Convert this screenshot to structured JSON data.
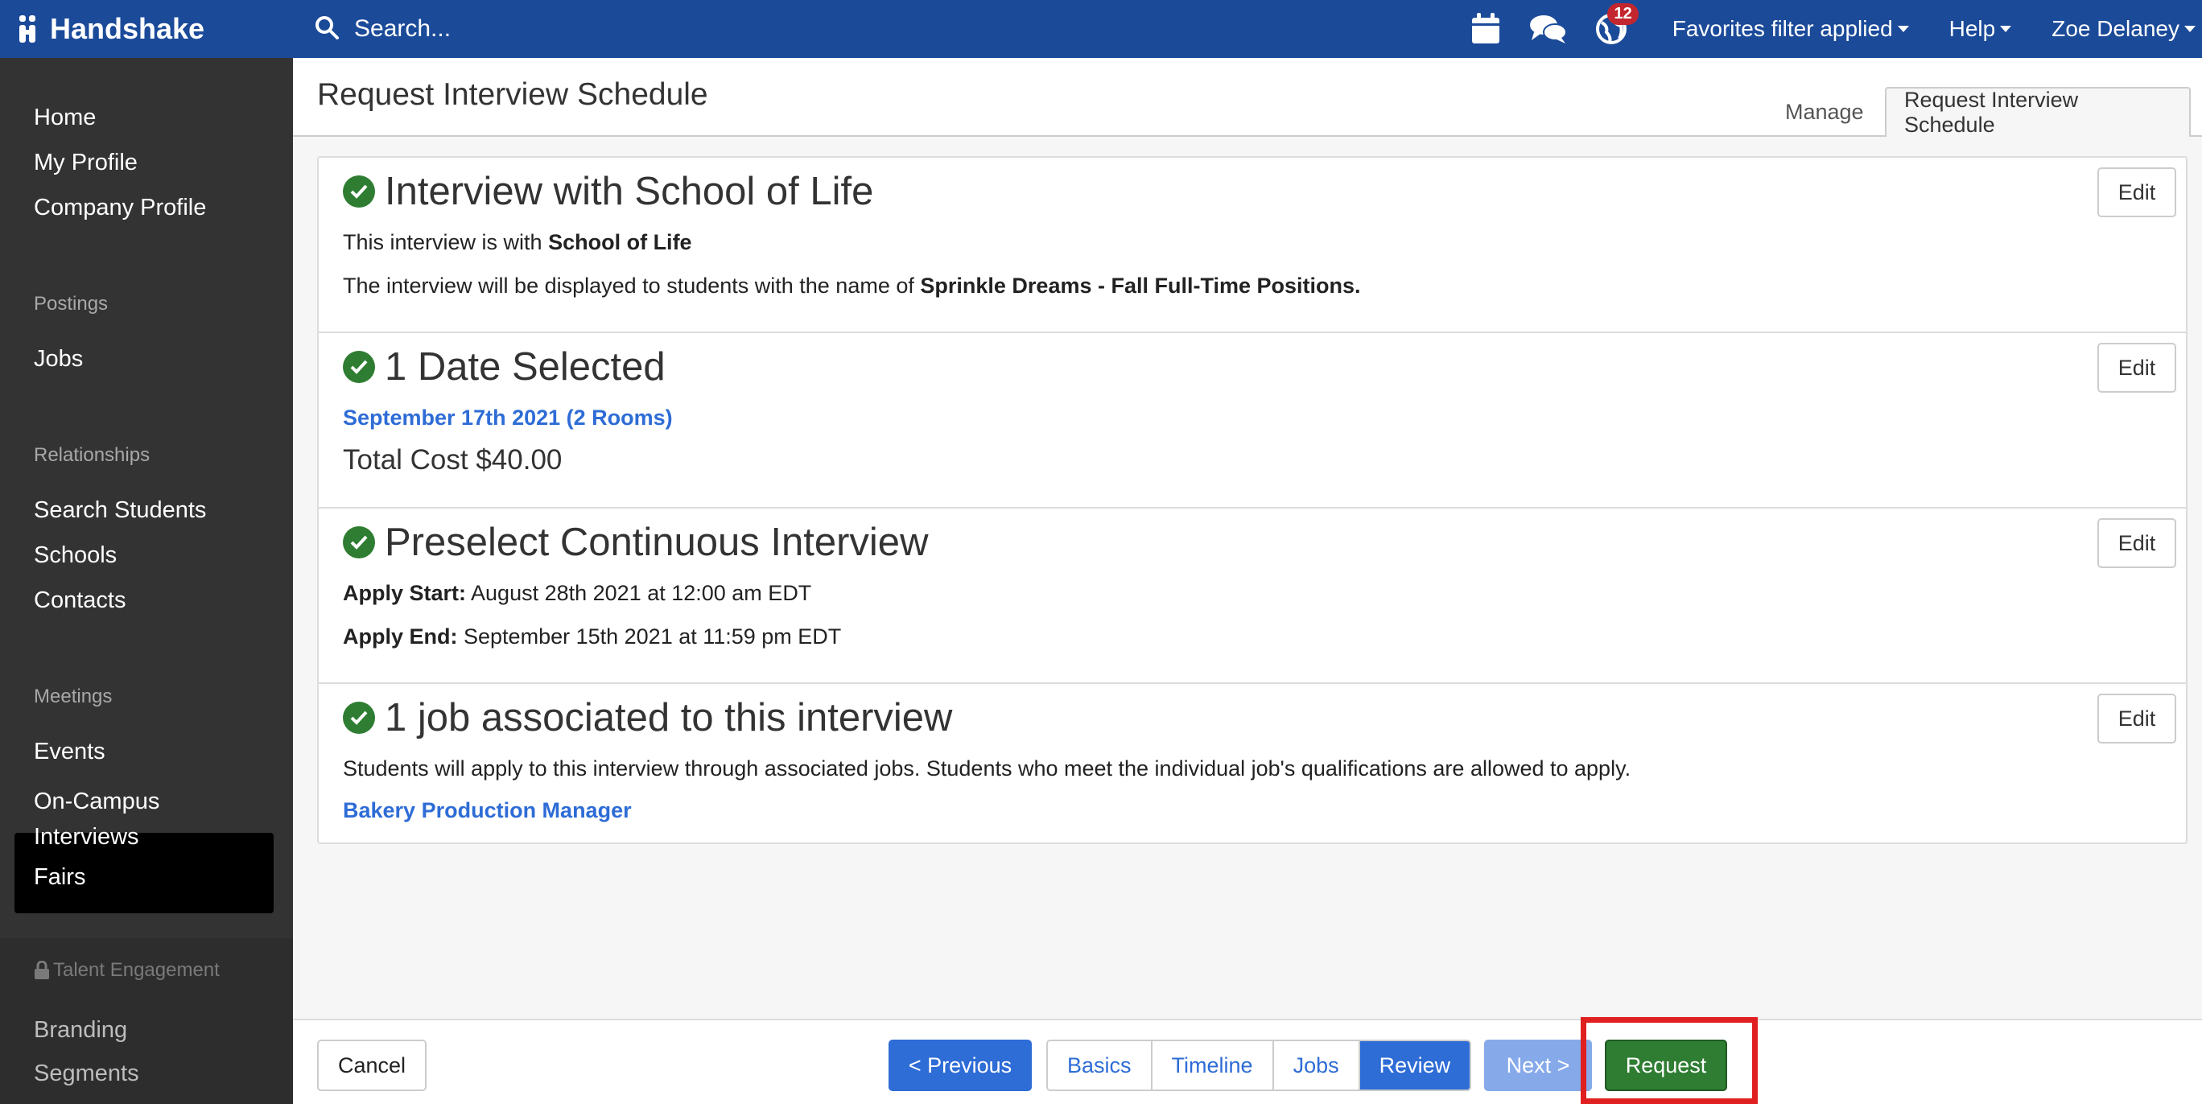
{
  "app": {
    "name": "Handshake"
  },
  "topbar": {
    "search_placeholder": "Search...",
    "notification_count": "12",
    "favorites_label": "Favorites filter applied",
    "help_label": "Help",
    "user_name": "Zoe Delaney"
  },
  "sidebar": {
    "items_top": [
      "Home",
      "My Profile",
      "Company Profile"
    ],
    "postings_heading": "Postings",
    "postings_items": [
      "Jobs"
    ],
    "relationships_heading": "Relationships",
    "relationships_items": [
      "Search Students",
      "Schools",
      "Contacts"
    ],
    "meetings_heading": "Meetings",
    "meetings_items": [
      "Events",
      "On-Campus Interviews",
      "Fairs"
    ],
    "active_item": "On-Campus Interviews",
    "talent_heading": "Talent Engagement",
    "talent_items": [
      "Branding",
      "Segments"
    ]
  },
  "header": {
    "title": "Request Interview Schedule",
    "tabs": [
      "Manage",
      "Request Interview Schedule"
    ]
  },
  "sections": {
    "interview": {
      "title": "Interview with School of Life",
      "line1_prefix": "This interview is with",
      "line1_bold": "School of Life",
      "line2_prefix": "The interview will be displayed to students with the name of",
      "line2_bold": "Sprinkle Dreams - Fall Full-Time Positions."
    },
    "dates": {
      "title": "1 Date Selected",
      "date_link": "September 17th 2021 (2 Rooms)",
      "total_cost": "Total Cost $40.00"
    },
    "preselect": {
      "title": "Preselect Continuous Interview",
      "start_label": "Apply Start:",
      "start_value": "August 28th 2021 at 12:00 am EDT",
      "end_label": "Apply End:",
      "end_value": "September 15th 2021 at 11:59 pm EDT"
    },
    "jobs": {
      "title": "1 job associated to this interview",
      "description": "Students will apply to this interview through associated jobs. Students who meet the individual job's qualifications are allowed to apply.",
      "job_link": "Bakery Production Manager"
    },
    "edit_label": "Edit"
  },
  "footer": {
    "cancel": "Cancel",
    "previous": "< Previous",
    "steps": [
      "Basics",
      "Timeline",
      "Jobs",
      "Review"
    ],
    "active_step": "Review",
    "next": "Next >",
    "request": "Request"
  },
  "colors": {
    "topbar": "#1b4a99",
    "sidebar": "#333333",
    "link_blue": "#2e6cd6",
    "success_green": "#2e7d32",
    "highlight_red": "#e02020"
  }
}
